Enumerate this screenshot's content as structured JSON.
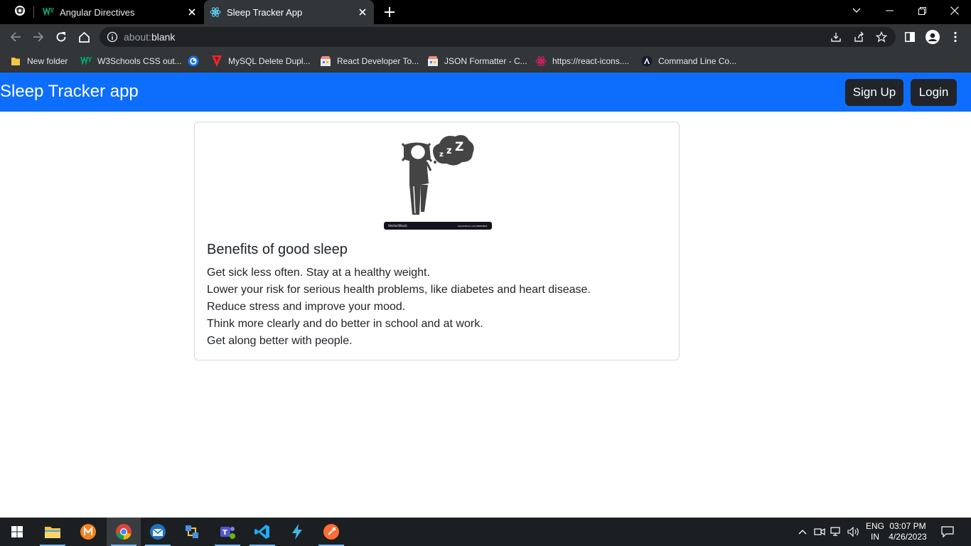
{
  "browser": {
    "tabs": [
      {
        "title": "Angular Directives",
        "icon": "w3schools-icon"
      },
      {
        "title": "Sleep Tracker App",
        "icon": "react-icon",
        "active": true
      }
    ],
    "url_host": "about:",
    "url_path": "blank",
    "bookmarks": [
      {
        "label": "New folder",
        "icon": "folder-icon"
      },
      {
        "label": "W3Schools CSS out...",
        "icon": "w3schools-icon"
      },
      {
        "label": "",
        "icon": "chrome-extension-icon"
      },
      {
        "label": "MySQL Delete Dupl...",
        "icon": "mysql-icon"
      },
      {
        "label": "React Developer To...",
        "icon": "store-icon"
      },
      {
        "label": "JSON Formatter - C...",
        "icon": "store-icon"
      },
      {
        "label": "https://react-icons....",
        "icon": "react-icon"
      },
      {
        "label": "Command Line Co...",
        "icon": "angular-icon"
      }
    ]
  },
  "app": {
    "brand": "Sleep Tracker app",
    "nav_buttons": {
      "signup": "Sign Up",
      "login": "Login"
    },
    "card": {
      "title": "Benefits of good sleep",
      "lines": [
        "Get sick less often. Stay at a healthy weight.",
        "Lower your risk for serious health problems, like diabetes and heart disease.",
        "Reduce stress and improve your mood.",
        "Think more clearly and do better in school and at work.",
        "Get along better with people."
      ],
      "image_caption_left": "VectorStock",
      "image_caption_right": "VectorStock.com/38064832"
    },
    "colors": {
      "navbar": "#0d6efd",
      "button": "#212529"
    }
  },
  "taskbar": {
    "apps": [
      "file-explorer-icon",
      "app-icon",
      "chrome-icon",
      "thunderbird-icon",
      "network-app-icon",
      "teams-icon",
      "vscode-icon",
      "lightning-app-icon",
      "postman-icon"
    ],
    "lang_top": "ENG",
    "lang_bottom": "IN",
    "time": "03:07 PM",
    "date": "4/26/2023"
  }
}
